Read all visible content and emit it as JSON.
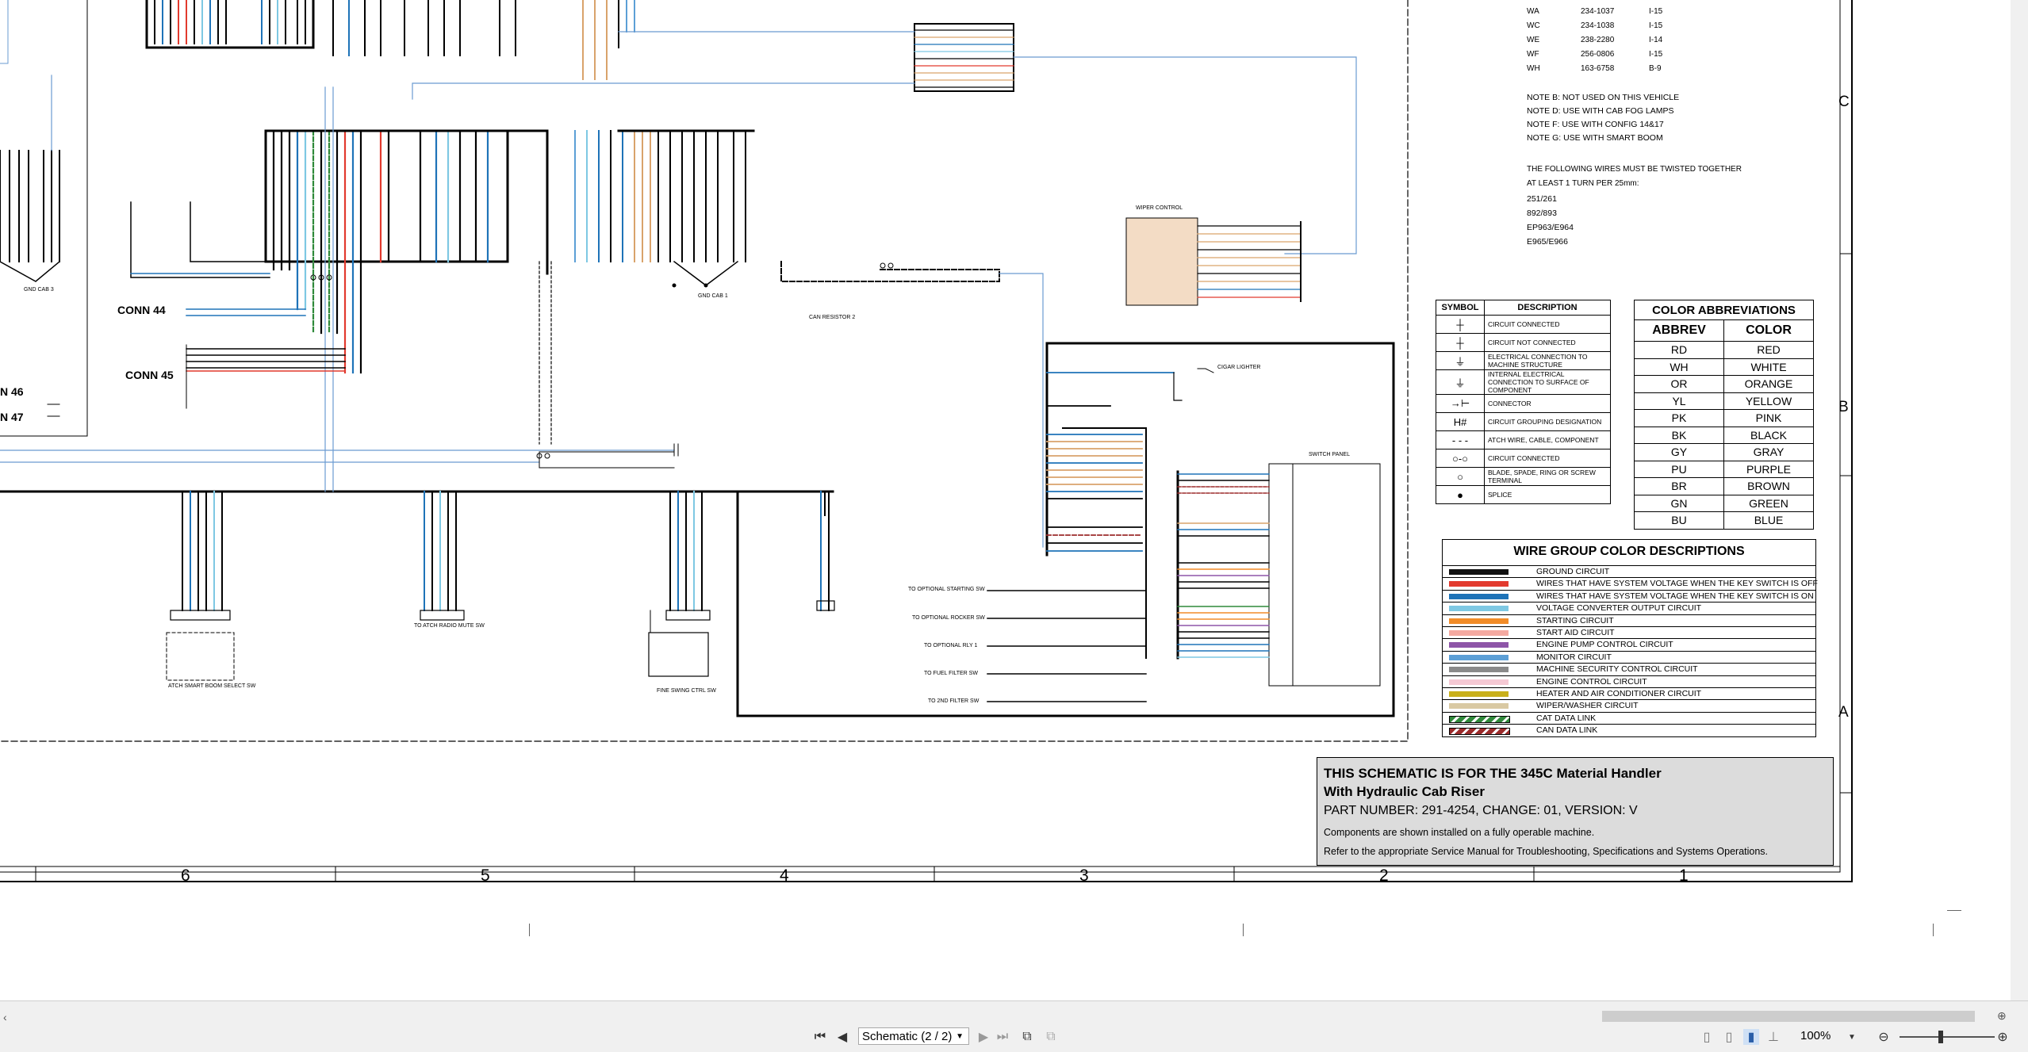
{
  "wire_list": [
    {
      "id": "WA",
      "part": "234-1037",
      "loc": "I-15"
    },
    {
      "id": "WC",
      "part": "234-1038",
      "loc": "I-15"
    },
    {
      "id": "WE",
      "part": "238-2280",
      "loc": "I-14"
    },
    {
      "id": "WF",
      "part": "256-0806",
      "loc": "I-15"
    },
    {
      "id": "WH",
      "part": "163-6758",
      "loc": "B-9"
    }
  ],
  "notes": [
    "NOTE B:  NOT USED ON THIS VEHICLE",
    "NOTE D:  USE WITH CAB FOG LAMPS",
    "NOTE F:  USE WITH CONFIG 14&17",
    "NOTE G:  USE WITH SMART BOOM"
  ],
  "twisted": {
    "line1": "THE FOLLOWING WIRES MUST BE TWISTED TOGETHER",
    "line2": " AT LEAST 1 TURN PER 25mm:",
    "pairs": [
      "251/261",
      "892/893",
      "EP963/E964",
      "E965/E966"
    ]
  },
  "symbol_table": {
    "headers": {
      "symbol": "SYMBOL",
      "description": "DESCRIPTION"
    },
    "rows": [
      {
        "sym": "┼",
        "desc": "CIRCUIT CONNECTED"
      },
      {
        "sym": "┼",
        "desc": "CIRCUIT NOT CONNECTED"
      },
      {
        "sym": "⏚",
        "desc": "ELECTRICAL CONNECTION TO MACHINE STRUCTURE"
      },
      {
        "sym": "⏚",
        "desc": "INTERNAL ELECTRICAL CONNECTION TO SURFACE OF COMPONENT"
      },
      {
        "sym": "→⊢",
        "desc": "CONNECTOR"
      },
      {
        "sym": "H#",
        "desc": "CIRCUIT GROUPING DESIGNATION"
      },
      {
        "sym": "- - -",
        "desc": "ATCH WIRE, CABLE, COMPONENT"
      },
      {
        "sym": "○-○",
        "desc": "CIRCUIT CONNECTED"
      },
      {
        "sym": "○",
        "desc": "BLADE, SPADE, RING OR SCREW TERMINAL"
      },
      {
        "sym": "●",
        "desc": "SPLICE"
      }
    ]
  },
  "color_abbrev": {
    "title": "COLOR ABBREVIATIONS",
    "headers": {
      "abbrev": "ABBREV",
      "color": "COLOR"
    },
    "rows": [
      {
        "a": "RD",
        "c": "RED"
      },
      {
        "a": "WH",
        "c": "WHITE"
      },
      {
        "a": "OR",
        "c": "ORANGE"
      },
      {
        "a": "YL",
        "c": "YELLOW"
      },
      {
        "a": "PK",
        "c": "PINK"
      },
      {
        "a": "BK",
        "c": "BLACK"
      },
      {
        "a": "GY",
        "c": "GRAY"
      },
      {
        "a": "PU",
        "c": "PURPLE"
      },
      {
        "a": "BR",
        "c": "BROWN"
      },
      {
        "a": "GN",
        "c": "GREEN"
      },
      {
        "a": "BU",
        "c": "BLUE"
      }
    ]
  },
  "wire_groups": {
    "title": "WIRE GROUP COLOR DESCRIPTIONS",
    "rows": [
      {
        "color": "#111111",
        "label": "GROUND CIRCUIT"
      },
      {
        "color": "#e23a2e",
        "label": "WIRES THAT HAVE SYSTEM VOLTAGE WHEN THE KEY SWITCH IS OFF"
      },
      {
        "color": "#1e73b8",
        "label": "WIRES THAT HAVE SYSTEM VOLTAGE WHEN THE KEY SWITCH IS ON"
      },
      {
        "color": "#7ec8e3",
        "label": "VOLTAGE CONVERTER OUTPUT CIRCUIT"
      },
      {
        "color": "#f28c28",
        "label": "STARTING CIRCUIT"
      },
      {
        "color": "#f4a9a0",
        "label": "START AID CIRCUIT"
      },
      {
        "color": "#8e55a8",
        "label": "ENGINE PUMP CONTROL CIRCUIT"
      },
      {
        "color": "#5c9fd6",
        "label": "MONITOR CIRCUIT"
      },
      {
        "color": "#8a8a8a",
        "label": "MACHINE SECURITY CONTROL CIRCUIT"
      },
      {
        "color": "#f5c9d4",
        "label": "ENGINE CONTROL CIRCUIT"
      },
      {
        "color": "#c9b01b",
        "label": "HEATER AND AIR CONDITIONER CIRCUIT"
      },
      {
        "color": "#d9c9a3",
        "label": "WIPER/WASHER CIRCUIT"
      },
      {
        "color": "#2f8a3a",
        "label": "CAT DATA LINK"
      },
      {
        "color": "#9c2b2b",
        "label": "CAN DATA LINK"
      }
    ]
  },
  "title_block": {
    "line1": "THIS SCHEMATIC IS FOR THE 345C Material Handler",
    "line2": "With Hydraulic Cab Riser",
    "line3": "PART NUMBER: 291-4254, CHANGE: 01, VERSION: V",
    "line4": "Components are shown installed on a fully operable machine.",
    "line5": "Refer to the appropriate Service Manual for Troubleshooting, Specifications and Systems Operations."
  },
  "grid": {
    "columns": [
      "6",
      "5",
      "4",
      "3",
      "2",
      "1"
    ],
    "rows": [
      "C",
      "B",
      "A"
    ]
  },
  "schematic_labels": {
    "conn44": "CONN 44",
    "conn45": "CONN 45",
    "conn46": "N 46",
    "conn47": "N 47",
    "wiper_control": "WIPER CONTROL",
    "switch_panel": "SWITCH PANEL",
    "cigar_lighter": "CIGAR LIGHTER",
    "can_resistor": "CAN RESISTOR 2",
    "gnd_cab1": "GND CAB 1",
    "gnd_cab3": "GND CAB 3",
    "fine_swing": "FINE SWING CTRL SW",
    "atch_radio": "TO ATCH RADIO MUTE SW",
    "atch_smart_boom": "ATCH SMART BOOM SELECT SW",
    "opt_starting": "TO OPTIONAL STARTING SW",
    "opt_rocker": "TO OPTIONAL ROCKER SW",
    "opt_rly": "TO OPTIONAL RLY 1",
    "fuel_filter": "TO FUEL FILTER SW",
    "second_filter": "TO 2ND FILTER SW"
  },
  "viewer": {
    "page_selector": "Schematic (2 / 2)",
    "zoom": "100%"
  }
}
